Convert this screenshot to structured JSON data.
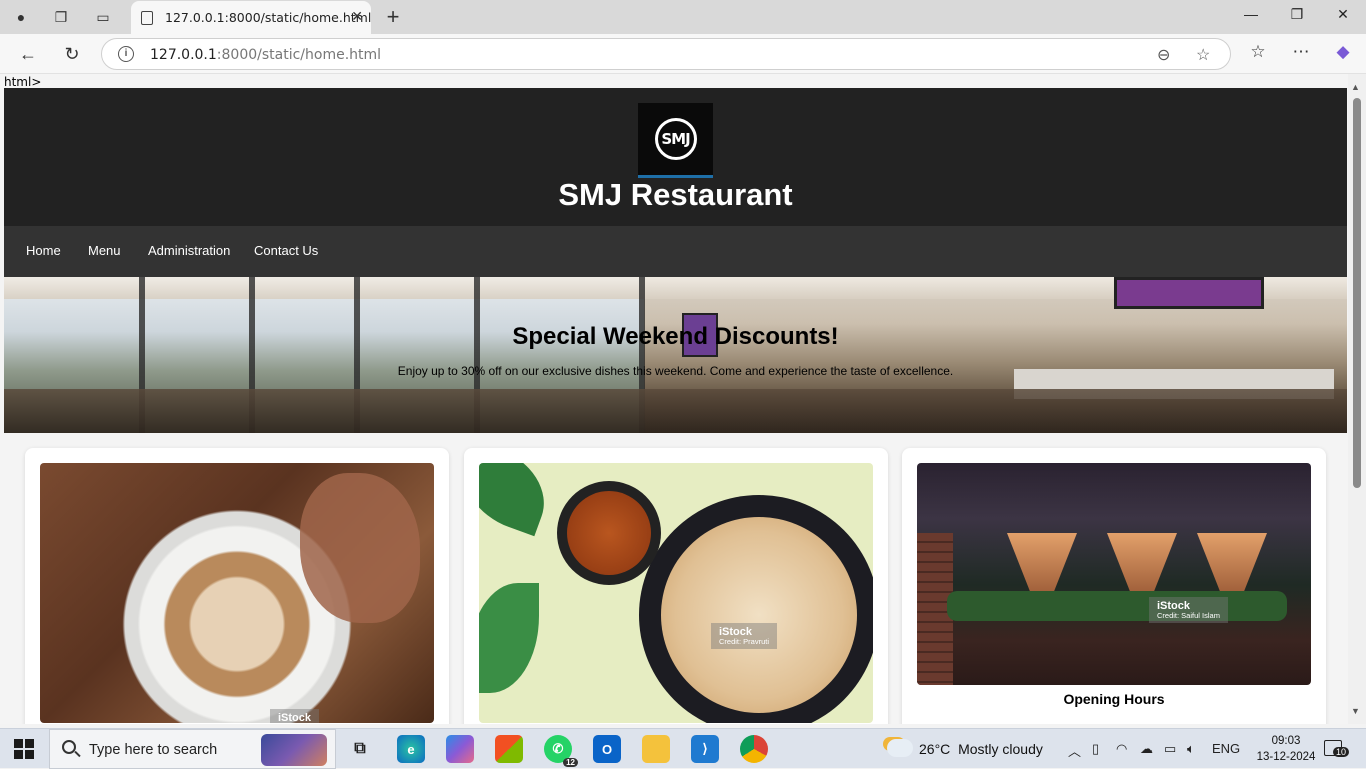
{
  "browser": {
    "tab_title": "127.0.0.1:8000/static/home.html",
    "url_host": "127.0.0.1",
    "url_rest": ":8000/static/home.html"
  },
  "page": {
    "raw_text": "html>",
    "site_title": "SMJ Restaurant",
    "logo_text": "SMJ",
    "nav": [
      "Home",
      "Menu",
      "Administration",
      "Contact Us"
    ],
    "hero": {
      "title": "Special Weekend Discounts!",
      "text": "Enjoy up to 30% off on our exclusive dishes this weekend. Come and experience the taste of excellence."
    },
    "cards": [
      {
        "watermark": "iStock",
        "credit": ""
      },
      {
        "watermark": "iStock",
        "credit": "Credit: Pravruti"
      },
      {
        "watermark": "iStock",
        "credit": "Credit: Saiful Islam",
        "title": "Opening Hours"
      }
    ]
  },
  "taskbar": {
    "search_placeholder": "Type here to search",
    "whatsapp_badge": "12",
    "weather_temp": "26°C",
    "weather_desc": "Mostly cloudy",
    "language": "ENG",
    "time": "09:03",
    "date": "13-12-2024",
    "notifications": "10"
  }
}
